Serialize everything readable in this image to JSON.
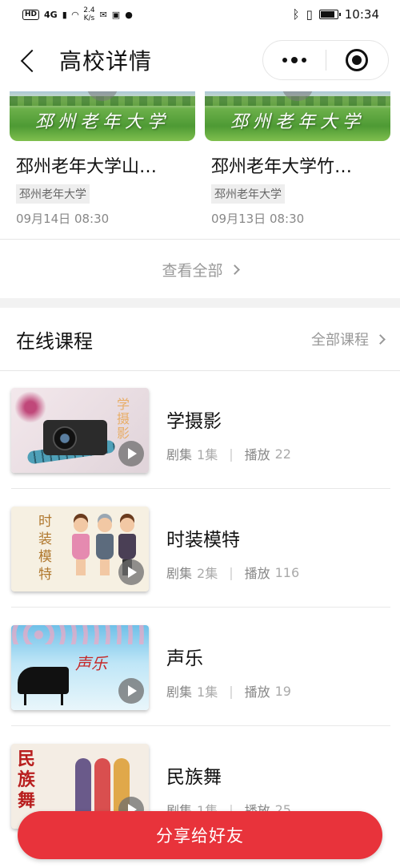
{
  "status_bar": {
    "left_badges": [
      "HD",
      "4G"
    ],
    "speed_value": "2.4",
    "speed_unit": "K/s",
    "time": "10:34",
    "battery_level": 0.9
  },
  "nav": {
    "title": "高校详情",
    "more_icon": "more-dots-icon",
    "close_icon": "target-close-icon"
  },
  "news": [
    {
      "thumb_text": "邳州老年大学",
      "title": "邳州老年大学山…",
      "tag": "邳州老年大学",
      "time": "09月14日 08:30"
    },
    {
      "thumb_text": "邳州老年大学",
      "title": "邳州老年大学竹…",
      "tag": "邳州老年大学",
      "time": "09月13日 08:30"
    }
  ],
  "view_all": "查看全部",
  "online_courses": {
    "title": "在线课程",
    "more": "全部课程",
    "items": [
      {
        "title": "学摄影",
        "episodes_label": "剧集",
        "episodes": "1集",
        "plays_label": "播放",
        "plays": "22",
        "art_text": "学摄影"
      },
      {
        "title": "时装模特",
        "episodes_label": "剧集",
        "episodes": "2集",
        "plays_label": "播放",
        "plays": "116",
        "art_text": "时装模特"
      },
      {
        "title": "声乐",
        "episodes_label": "剧集",
        "episodes": "1集",
        "plays_label": "播放",
        "plays": "19",
        "art_text": "声乐"
      },
      {
        "title": "民族舞",
        "episodes_label": "剧集",
        "episodes": "1集",
        "plays_label": "播放",
        "plays": "25",
        "art_text": "民族舞"
      }
    ]
  },
  "share_button": "分享给好友",
  "colors": {
    "accent": "#e8333b",
    "muted_text": "#999999"
  }
}
